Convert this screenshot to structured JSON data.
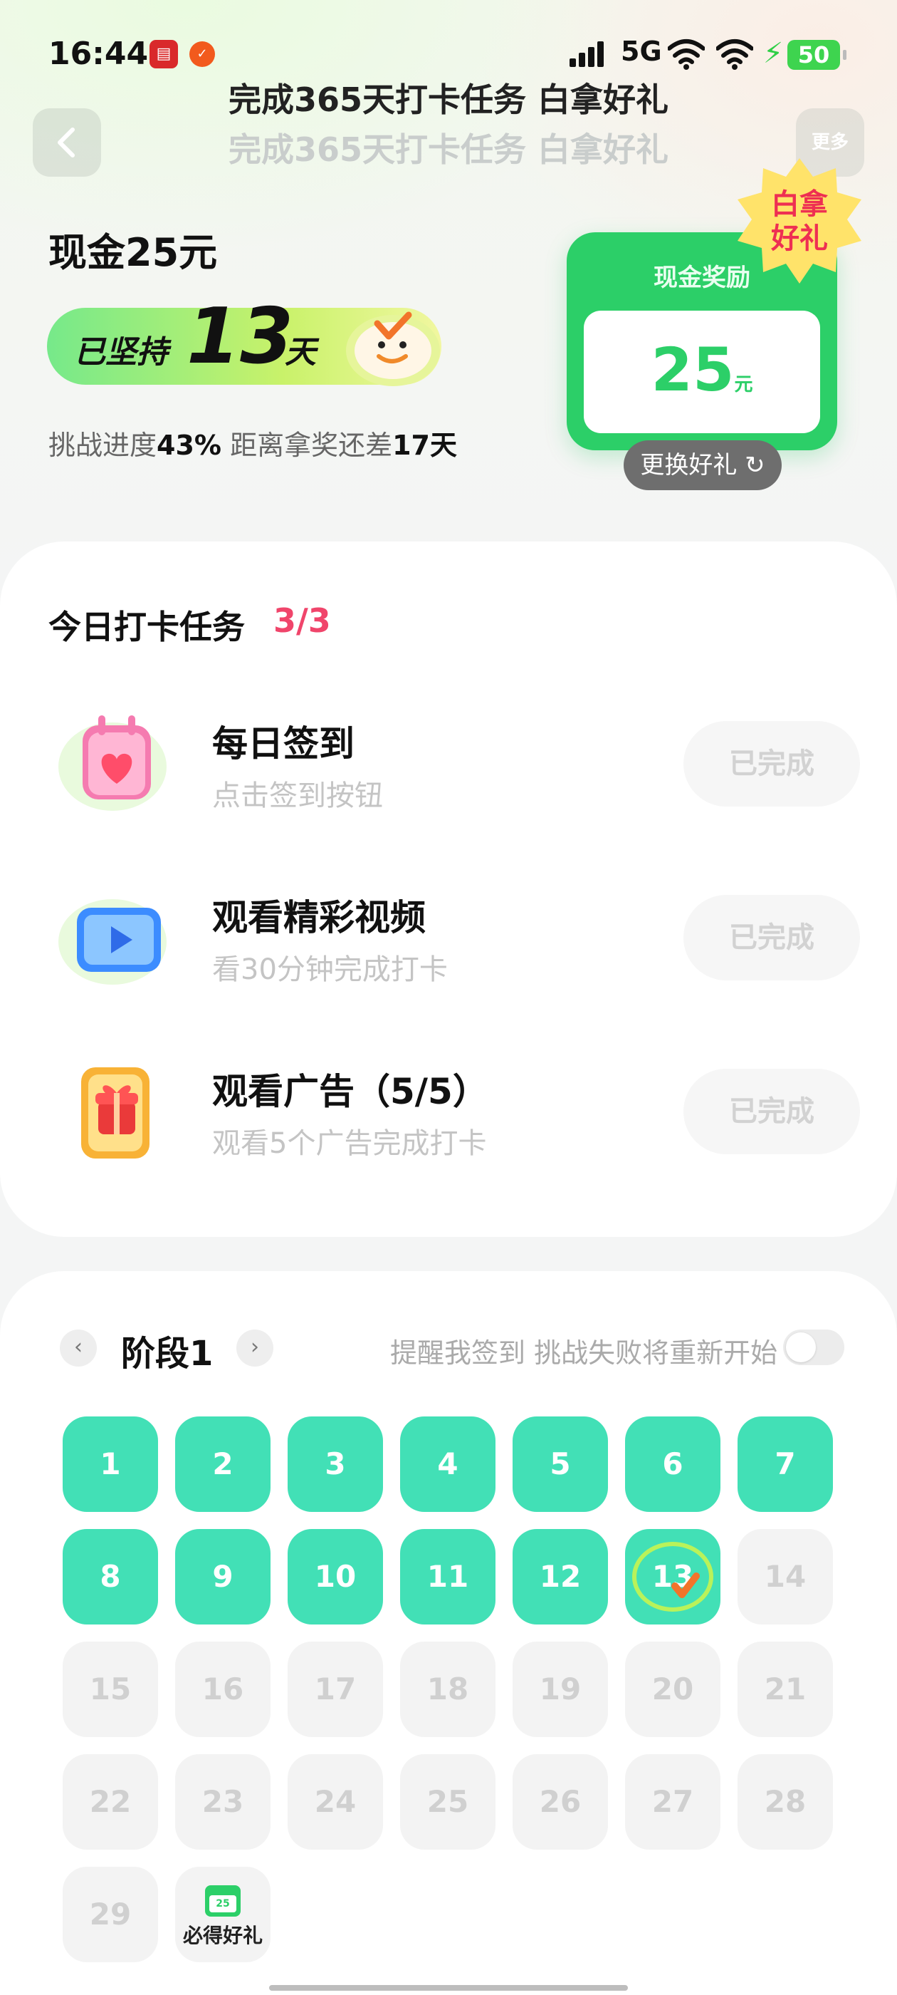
{
  "status_bar": {
    "time": "16:44",
    "network": "5G",
    "battery": "50",
    "app_icon_1": "calendar-app-icon",
    "app_icon_2": "shopping-app-icon"
  },
  "header": {
    "title": "完成365天打卡任务 白拿好礼",
    "title_shadow": "完成365天打卡任务 白拿好礼",
    "more_label": "更多"
  },
  "hero": {
    "prize_name": "现金25元",
    "streak_prefix": "已坚持",
    "streak_days": "13",
    "streak_suffix": "天",
    "progress_label": "挑战进度",
    "progress_value": "43%",
    "remaining_label": "距离拿奖还差",
    "remaining_value": "17天"
  },
  "prize_card": {
    "title": "现金奖励",
    "amount": "25",
    "unit": "元",
    "badge_line1": "白拿",
    "badge_line2": "好礼",
    "swap_label": "更换好礼",
    "swap_icon": "refresh-icon"
  },
  "tasks": {
    "heading": "今日打卡任务",
    "count": "3/3",
    "items": [
      {
        "title": "每日签到",
        "subtitle": "点击签到按钮",
        "button": "已完成",
        "icon": "calendar-heart-icon"
      },
      {
        "title": "观看精彩视频",
        "subtitle": "看30分钟完成打卡",
        "button": "已完成",
        "icon": "video-play-icon"
      },
      {
        "title": "观看广告（5/5）",
        "subtitle": "观看5个广告完成打卡",
        "button": "已完成",
        "icon": "gift-phone-icon"
      }
    ]
  },
  "calendar": {
    "stage": "阶段1",
    "reminder": "提醒我签到 挑战失败将重新开始",
    "reminder_on": false,
    "completed_days": 13,
    "days": [
      "1",
      "2",
      "3",
      "4",
      "5",
      "6",
      "7",
      "8",
      "9",
      "10",
      "11",
      "12",
      "13",
      "14",
      "15",
      "16",
      "17",
      "18",
      "19",
      "20",
      "21",
      "22",
      "23",
      "24",
      "25",
      "26",
      "27",
      "28",
      "29"
    ],
    "final_tile_label": "必得好礼",
    "final_tile_mini_amount": "25",
    "colors": {
      "done": "#42e0b6",
      "todo": "#f3f3f3",
      "accent": "#f0456b",
      "prize_green": "#2ccf68"
    }
  }
}
